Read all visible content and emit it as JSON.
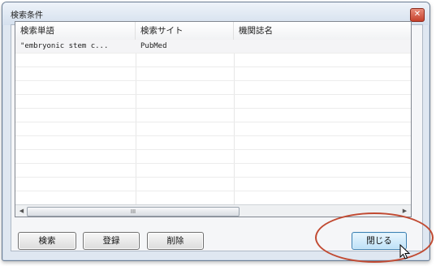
{
  "window": {
    "title": "検索条件",
    "close_glyph": "✕"
  },
  "list": {
    "columns": [
      "検索単語",
      "検索サイト",
      "機関誌名"
    ],
    "rows": [
      {
        "term": "\"embryonic stem c...",
        "site": "PubMed",
        "journal": ""
      }
    ]
  },
  "scrollbar": {
    "left_arrow": "◀",
    "right_arrow": "▶",
    "thumb_grip": "III"
  },
  "buttons": {
    "search": "検索",
    "register": "登録",
    "delete": "削除",
    "close": "閉じる"
  },
  "colors": {
    "annotation": "#c14a32",
    "focus_border": "#3c7fb1"
  }
}
